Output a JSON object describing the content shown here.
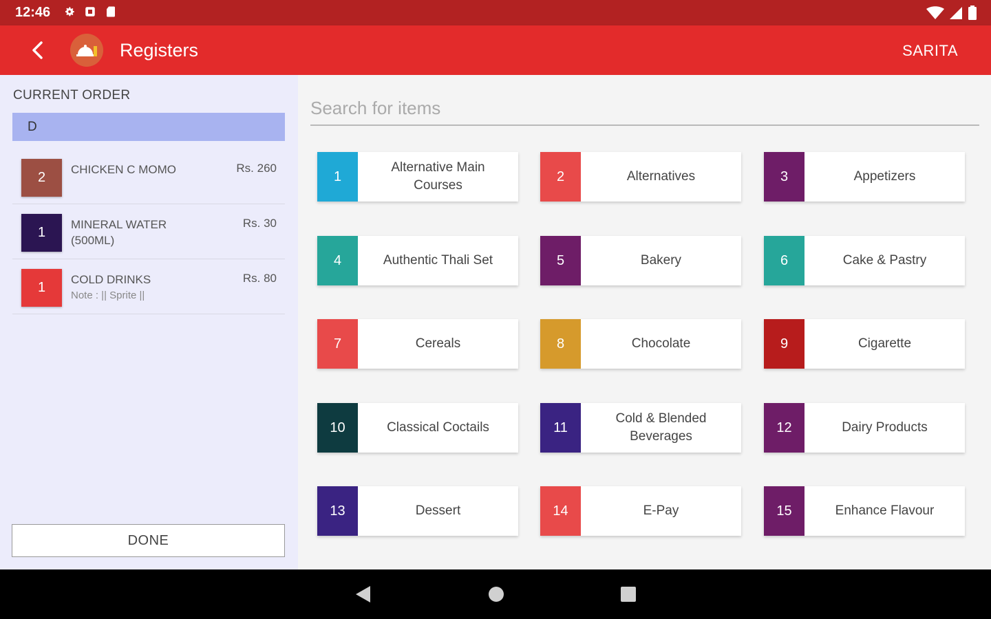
{
  "status_bar": {
    "time": "12:46",
    "left_icons": [
      "gear-icon",
      "notification-icon",
      "sd-card-icon"
    ],
    "right_icons": [
      "wifi-icon",
      "signal-icon",
      "battery-icon"
    ]
  },
  "app_bar": {
    "title": "Registers",
    "user": "SARITA",
    "colors": {
      "app_bar": "#e32b2b",
      "status_bar": "#b22222"
    }
  },
  "current_order": {
    "title": "CURRENT ORDER",
    "order_id": "D",
    "items": [
      {
        "qty": "2",
        "name": "CHICKEN C MOMO",
        "price": "Rs. 260",
        "note": "",
        "color": "#9c4f43"
      },
      {
        "qty": "1",
        "name": "MINERAL WATER (500ML)",
        "price": "Rs. 30",
        "note": "",
        "color": "#2b1552"
      },
      {
        "qty": "1",
        "name": "COLD DRINKS",
        "price": "Rs. 80",
        "note": "Note : || Sprite ||",
        "color": "#e53939"
      }
    ],
    "done_label": "DONE"
  },
  "search": {
    "placeholder": "Search for items",
    "value": ""
  },
  "categories": [
    {
      "num": "1",
      "label": "Alternative Main Courses",
      "color": "#1fa9d6"
    },
    {
      "num": "2",
      "label": "Alternatives",
      "color": "#e84a4a"
    },
    {
      "num": "3",
      "label": "Appetizers",
      "color": "#6e1d67"
    },
    {
      "num": "4",
      "label": "Authentic Thali Set",
      "color": "#26a69a"
    },
    {
      "num": "5",
      "label": "Bakery",
      "color": "#6e1d67"
    },
    {
      "num": "6",
      "label": "Cake & Pastry",
      "color": "#26a69a"
    },
    {
      "num": "7",
      "label": "Cereals",
      "color": "#e84a4a"
    },
    {
      "num": "8",
      "label": "Chocolate",
      "color": "#d69a2c"
    },
    {
      "num": "9",
      "label": "Cigarette",
      "color": "#b71c1c"
    },
    {
      "num": "10",
      "label": "Classical Coctails",
      "color": "#0e3b40"
    },
    {
      "num": "11",
      "label": "Cold & Blended Beverages",
      "color": "#3a2382"
    },
    {
      "num": "12",
      "label": "Dairy Products",
      "color": "#6e1d67"
    },
    {
      "num": "13",
      "label": "Dessert",
      "color": "#3a2382"
    },
    {
      "num": "14",
      "label": "E-Pay",
      "color": "#e84a4a"
    },
    {
      "num": "15",
      "label": "Enhance Flavour",
      "color": "#6e1d67"
    }
  ],
  "nav": {
    "icons": [
      "back-triangle-icon",
      "home-circle-icon",
      "recents-square-icon"
    ]
  }
}
